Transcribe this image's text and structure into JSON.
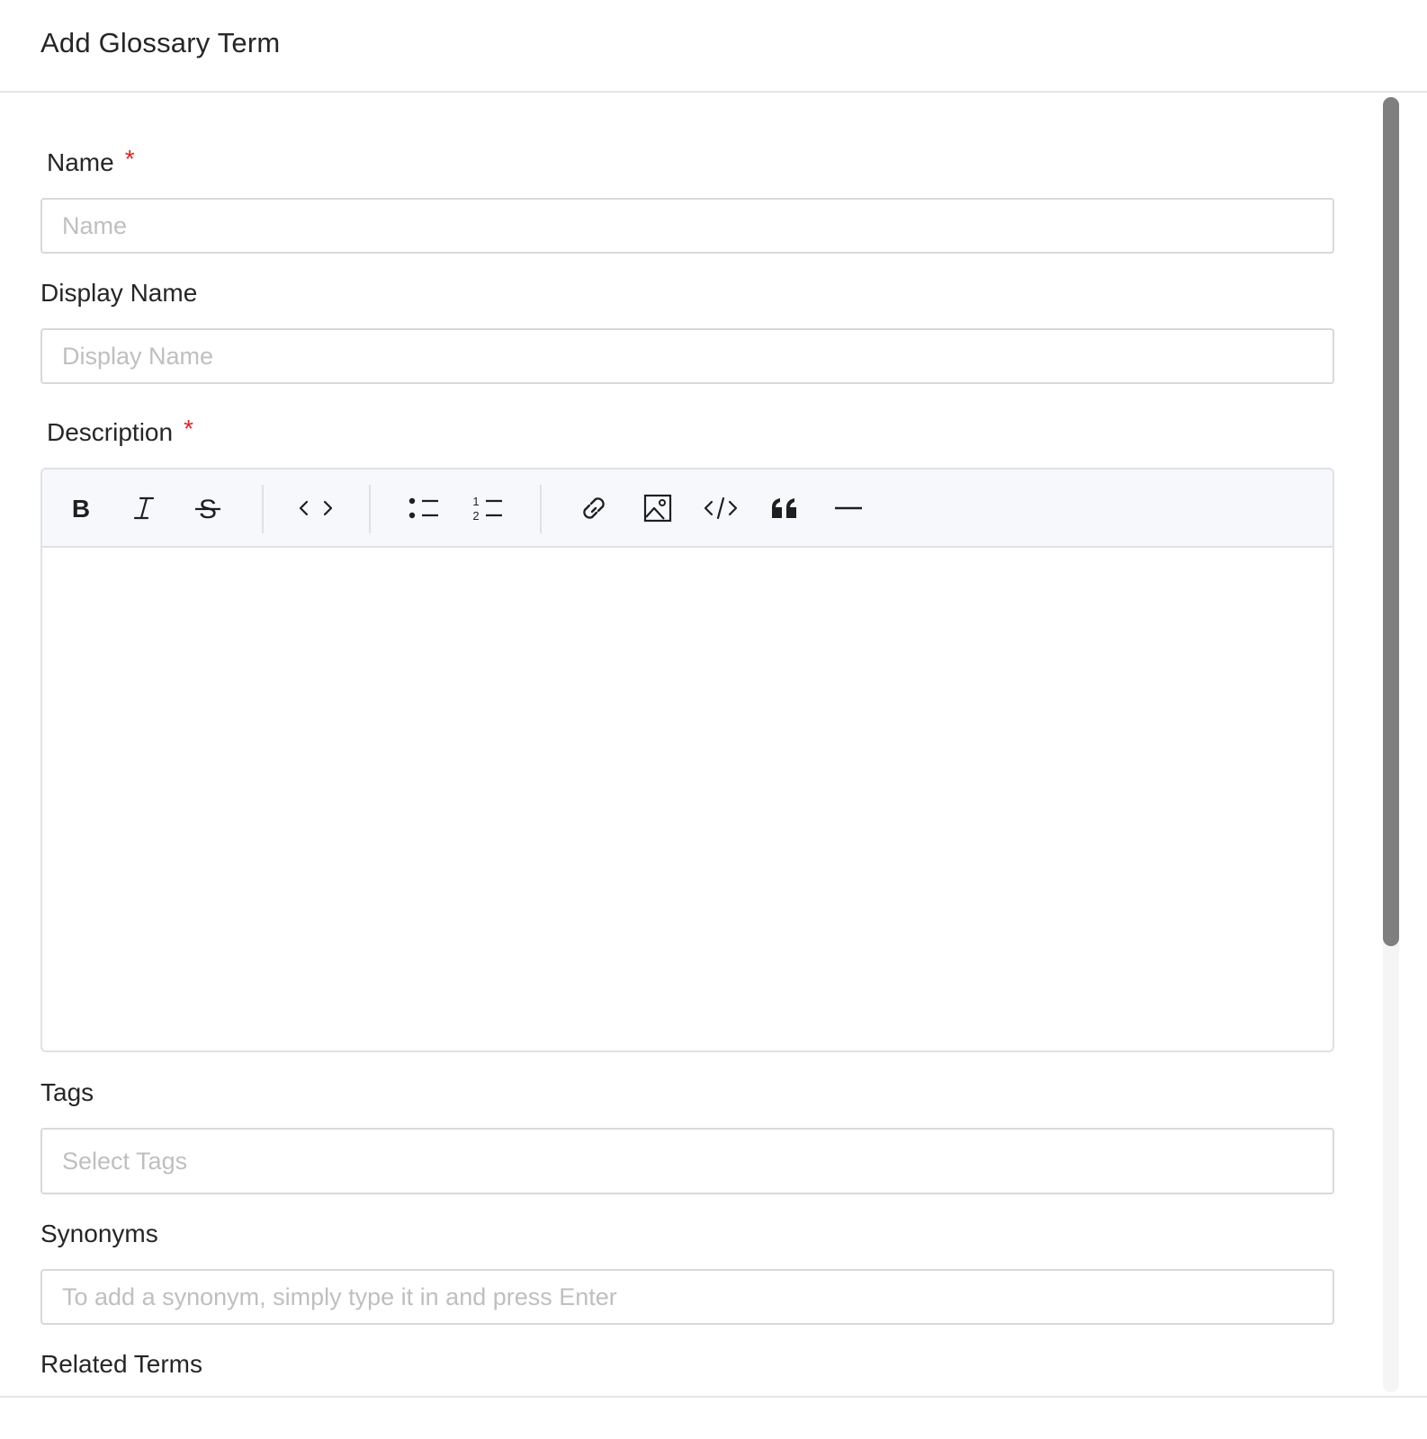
{
  "dialog": {
    "title": "Add Glossary Term"
  },
  "fields": {
    "name": {
      "label": "Name",
      "required_mark": "*",
      "placeholder": "Name",
      "value": ""
    },
    "display_name": {
      "label": "Display Name",
      "placeholder": "Display Name",
      "value": ""
    },
    "description": {
      "label": "Description",
      "required_mark": "*",
      "value": ""
    },
    "tags": {
      "label": "Tags",
      "placeholder": "Select Tags"
    },
    "synonyms": {
      "label": "Synonyms",
      "placeholder": "To add a synonym, simply type it in and press Enter"
    },
    "related_terms": {
      "label": "Related Terms"
    }
  },
  "toolbar": {
    "buttons": [
      {
        "icon": "bold-icon",
        "glyph": "B"
      },
      {
        "icon": "italic-icon",
        "glyph": "I"
      },
      {
        "icon": "strikethrough-icon",
        "glyph": "S"
      },
      {
        "icon": "inline-code-icon"
      },
      {
        "icon": "bullet-list-icon"
      },
      {
        "icon": "ordered-list-icon"
      },
      {
        "icon": "link-icon"
      },
      {
        "icon": "image-icon"
      },
      {
        "icon": "code-block-icon"
      },
      {
        "icon": "blockquote-icon"
      },
      {
        "icon": "horizontal-rule-icon"
      }
    ]
  },
  "colors": {
    "required": "#e02424",
    "placeholder": "#bfbfbf",
    "border": "#d9d9d9",
    "toolbar_bg": "#f7f8fb",
    "scroll_thumb": "#7f7f7f"
  }
}
